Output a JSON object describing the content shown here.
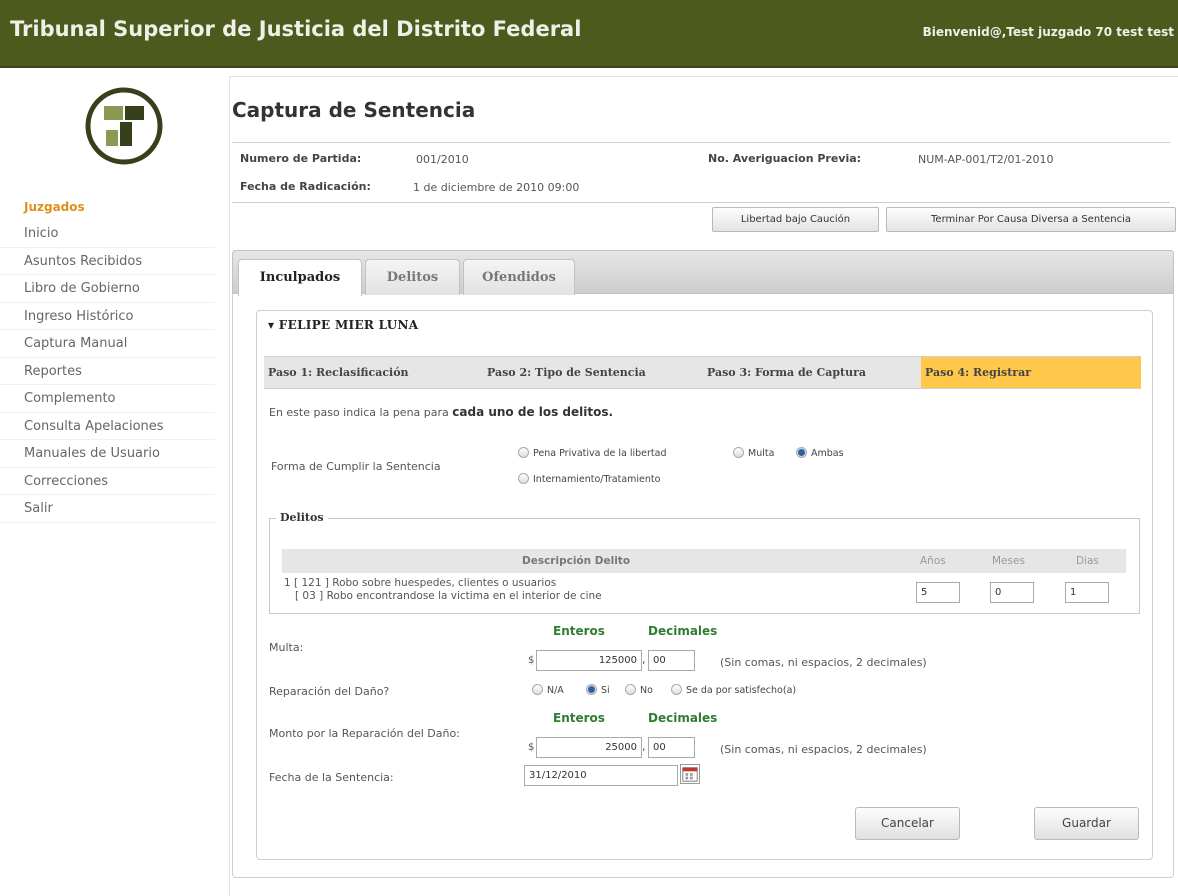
{
  "header": {
    "title": "Tribunal Superior de Justicia del Distrito Federal",
    "welcome": "Bienvenid@,Test juzgado 70 test test"
  },
  "sidebar": {
    "section": "Juzgados",
    "items": [
      {
        "label": "Inicio"
      },
      {
        "label": "Asuntos Recibidos"
      },
      {
        "label": "Libro de Gobierno"
      },
      {
        "label": "Ingreso Histórico"
      },
      {
        "label": "Captura Manual"
      },
      {
        "label": "Reportes"
      },
      {
        "label": "Complemento"
      },
      {
        "label": "Consulta Apelaciones"
      },
      {
        "label": "Manuales de Usuario"
      },
      {
        "label": "Correcciones"
      },
      {
        "label": "Salir"
      }
    ]
  },
  "page": {
    "title": "Captura de Sentencia",
    "numero_partida_label": "Numero de Partida:",
    "numero_partida": "001/2010",
    "averiguacion_label": "No. Averiguacion Previa:",
    "averiguacion": "NUM-AP-001/T2/01-2010",
    "fecha_radicacion_label": "Fecha de Radicación:",
    "fecha_radicacion": "1 de diciembre de 2010 09:00",
    "btn_libertad": "Libertad bajo Caución",
    "btn_terminar": "Terminar Por Causa Diversa a Sentencia"
  },
  "tabs": [
    {
      "label": "Inculpados",
      "active": true
    },
    {
      "label": "Delitos",
      "active": false
    },
    {
      "label": "Ofendidos",
      "active": false
    }
  ],
  "inculpado": {
    "name": "▾ FELIPE MIER LUNA",
    "steps": [
      {
        "label": "Paso 1: Reclasificación",
        "active": false
      },
      {
        "label": "Paso 2: Tipo de Sentencia",
        "active": false
      },
      {
        "label": "Paso 3: Forma de Captura",
        "active": false
      },
      {
        "label": "Paso 4: Registrar",
        "active": true
      }
    ],
    "instruction_prefix": "En este paso indica la pena para ",
    "instruction_bold": "cada uno de los delitos.",
    "forma_label": "Forma de Cumplir la Sentencia",
    "forma_options": [
      {
        "label": "Pena Privativa de la libertad",
        "selected": false
      },
      {
        "label": "Multa",
        "selected": false
      },
      {
        "label": "Ambas",
        "selected": true
      },
      {
        "label": "Internamiento/Tratamiento",
        "selected": false
      }
    ],
    "delitos": {
      "legend": "Delitos",
      "columns": [
        "Descripción Delito",
        "Años",
        "Meses",
        "Dias"
      ],
      "rows": [
        {
          "line1": "1 [ 121 ] Robo sobre huespedes, clientes o usuarios",
          "line2": "[ 03 ] Robo encontrandose la victima en el interior de cine",
          "anios": "5",
          "meses": "0",
          "dias": "1"
        }
      ]
    },
    "enteros_label": "Enteros",
    "decimales_label": "Decimales",
    "currency": "$",
    "comma": ",",
    "multa_label": "Multa:",
    "multa_enteros": "125000",
    "multa_decimales": "00",
    "hint": "(Sin comas, ni espacios, 2 decimales)",
    "reparacion_label": "Reparación del Daño?",
    "reparacion_options": [
      {
        "label": "N/A",
        "selected": false
      },
      {
        "label": "Si",
        "selected": true
      },
      {
        "label": "No",
        "selected": false
      },
      {
        "label": "Se da por satisfecho(a)",
        "selected": false
      }
    ],
    "monto_label": "Monto por la Reparación del Daño:",
    "monto_enteros": "25000",
    "monto_decimales": "00",
    "fecha_label": "Fecha de la Sentencia:",
    "fecha": "31/12/2010",
    "btn_cancelar": "Cancelar",
    "btn_guardar": "Guardar"
  },
  "colors": {
    "header_bg": "#4d5a1e",
    "section": "#e0901a",
    "active_step": "#ffc84a",
    "green_label": "#2e7d32"
  }
}
